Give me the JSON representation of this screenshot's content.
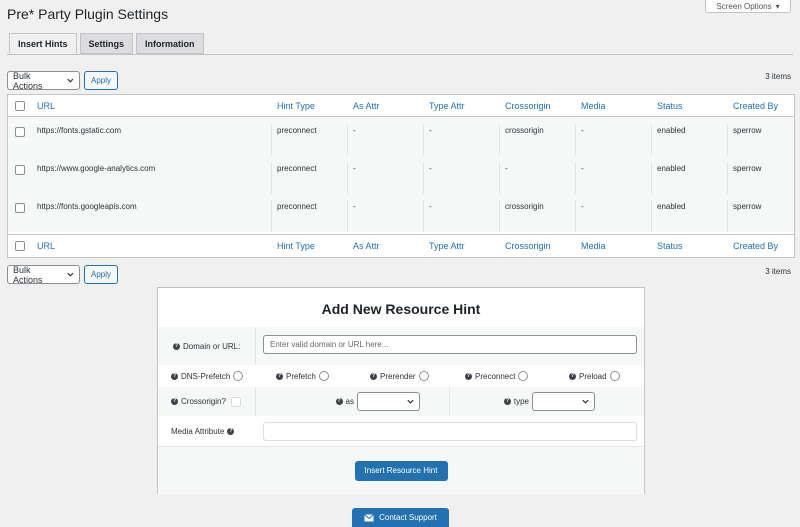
{
  "screen_options": {
    "label": "Screen Options"
  },
  "page": {
    "title": "Pre* Party Plugin Settings"
  },
  "tabs": [
    {
      "label": "Insert Hints",
      "active": true
    },
    {
      "label": "Settings",
      "active": false
    },
    {
      "label": "Information",
      "active": false
    }
  ],
  "bulk_top": {
    "select_label": "Bulk Actions",
    "apply_label": "Apply",
    "count": "3 items"
  },
  "bulk_bottom": {
    "select_label": "Bulk Actions",
    "apply_label": "Apply",
    "count": "3 items"
  },
  "table": {
    "columns": [
      "URL",
      "Hint Type",
      "As Attr",
      "Type Attr",
      "Crossorigin",
      "Media",
      "Status",
      "Created By"
    ],
    "rows": [
      {
        "url": "https://fonts.gstatic.com",
        "hint_type": "preconnect",
        "as_attr": "-",
        "type_attr": "-",
        "crossorigin": "crossorigin",
        "media": "-",
        "status": "enabled",
        "created_by": "sperrow"
      },
      {
        "url": "https://www.google-analytics.com",
        "hint_type": "preconnect",
        "as_attr": "-",
        "type_attr": "-",
        "crossorigin": "-",
        "media": "-",
        "status": "enabled",
        "created_by": "sperrow"
      },
      {
        "url": "https://fonts.googleapis.com",
        "hint_type": "preconnect",
        "as_attr": "-",
        "type_attr": "-",
        "crossorigin": "crossorigin",
        "media": "-",
        "status": "enabled",
        "created_by": "sperrow"
      }
    ]
  },
  "add_hint": {
    "title": "Add New Resource Hint",
    "domain_label": "Domain or URL:",
    "domain_placeholder": "Enter valid domain or URL here...",
    "hint_types": [
      "DNS-Prefetch",
      "Prefetch",
      "Prerender",
      "Preconnect",
      "Preload"
    ],
    "crossorigin_label": "Crossorigin?",
    "as_label": "as",
    "type_label": "type",
    "media_label": "Media Attribute",
    "insert_button": "Insert Resource Hint"
  },
  "support": {
    "button_label": "Contact Support"
  },
  "colors": {
    "accent": "#2271b1",
    "background": "#f0f0f1"
  }
}
